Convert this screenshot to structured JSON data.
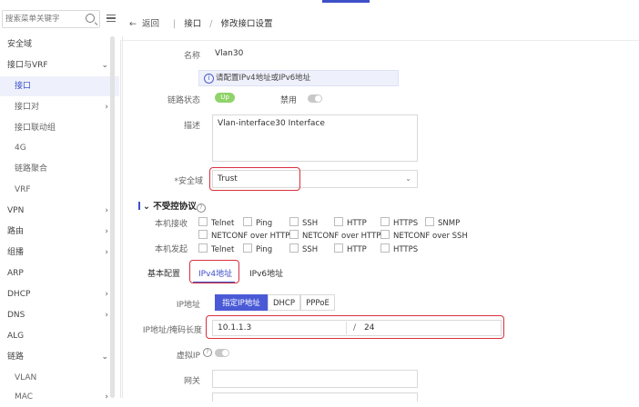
{
  "sidebar": {
    "search_placeholder": "搜索菜单关键字",
    "items": [
      {
        "label": "安全域"
      },
      {
        "label": "接口与VRF"
      },
      {
        "label": "接口"
      },
      {
        "label": "接口对"
      },
      {
        "label": "接口联动组"
      },
      {
        "label": "4G"
      },
      {
        "label": "链路聚合"
      },
      {
        "label": "VRF"
      },
      {
        "label": "VPN"
      },
      {
        "label": "路由"
      },
      {
        "label": "组播"
      },
      {
        "label": "ARP"
      },
      {
        "label": "DHCP"
      },
      {
        "label": "DNS"
      },
      {
        "label": "ALG"
      },
      {
        "label": "链路"
      },
      {
        "label": "VLAN"
      },
      {
        "label": "MAC"
      }
    ]
  },
  "breadcrumb": {
    "back": "返回",
    "level1": "接口",
    "sep": "/",
    "level2": "修改接口设置"
  },
  "form": {
    "name_label": "名称",
    "name_value": "Vlan30",
    "notice": "请配置IPv4地址或IPv6地址",
    "link_status_label": "链路状态",
    "link_status_value": "Up",
    "disable_label": "禁用",
    "desc_label": "描述",
    "desc_value": "Vlan-interface30 Interface",
    "zone_label": "*安全域",
    "zone_value": "Trust",
    "section_title": "不受控协议",
    "local_recv_label": "本机接收",
    "local_send_label": "本机发起",
    "recv_protocols": [
      "Telnet",
      "Ping",
      "SSH",
      "HTTP",
      "HTTPS",
      "SNMP",
      "NETCONF over HTTP",
      "NETCONF over HTTPS",
      "NETCONF over SSH"
    ],
    "send_protocols": [
      "Telnet",
      "Ping",
      "SSH",
      "HTTP",
      "HTTPS"
    ]
  },
  "tabs": {
    "basic": "基本配置",
    "ipv4": "IPv4地址",
    "ipv6": "IPv6地址"
  },
  "ipv4": {
    "ip_label": "IP地址",
    "mode_options": [
      "指定IP地址",
      "DHCP",
      "PPPoE"
    ],
    "mask_label": "IP地址/掩码长度",
    "ip_value": "10.1.1.3",
    "slash": "/",
    "mask_value": "24",
    "virtual_ip_label": "虚拟IP",
    "gateway_label": "网关"
  },
  "colors": {
    "accent": "#3e50c8",
    "highlight": "#d9303e",
    "status_up": "#8fd36a"
  }
}
